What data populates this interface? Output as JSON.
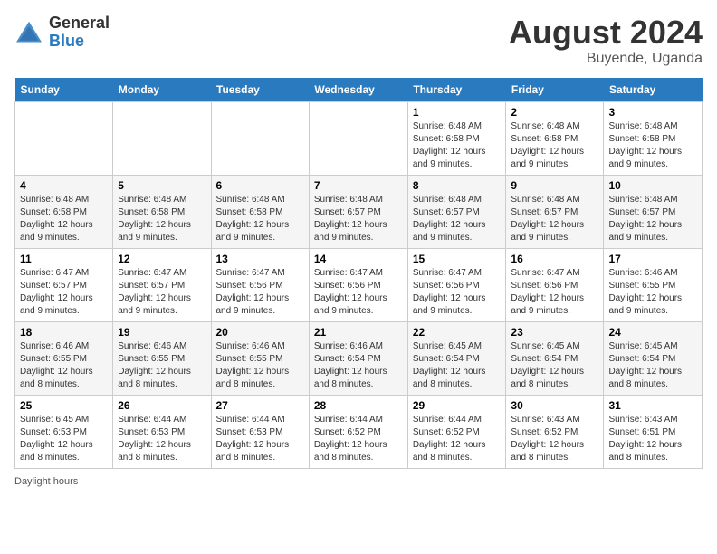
{
  "header": {
    "logo_general": "General",
    "logo_blue": "Blue",
    "month_year": "August 2024",
    "location": "Buyende, Uganda"
  },
  "columns": [
    "Sunday",
    "Monday",
    "Tuesday",
    "Wednesday",
    "Thursday",
    "Friday",
    "Saturday"
  ],
  "weeks": [
    [
      {
        "day": "",
        "info": ""
      },
      {
        "day": "",
        "info": ""
      },
      {
        "day": "",
        "info": ""
      },
      {
        "day": "",
        "info": ""
      },
      {
        "day": "1",
        "info": "Sunrise: 6:48 AM\nSunset: 6:58 PM\nDaylight: 12 hours and 9 minutes."
      },
      {
        "day": "2",
        "info": "Sunrise: 6:48 AM\nSunset: 6:58 PM\nDaylight: 12 hours and 9 minutes."
      },
      {
        "day": "3",
        "info": "Sunrise: 6:48 AM\nSunset: 6:58 PM\nDaylight: 12 hours and 9 minutes."
      }
    ],
    [
      {
        "day": "4",
        "info": "Sunrise: 6:48 AM\nSunset: 6:58 PM\nDaylight: 12 hours and 9 minutes."
      },
      {
        "day": "5",
        "info": "Sunrise: 6:48 AM\nSunset: 6:58 PM\nDaylight: 12 hours and 9 minutes."
      },
      {
        "day": "6",
        "info": "Sunrise: 6:48 AM\nSunset: 6:58 PM\nDaylight: 12 hours and 9 minutes."
      },
      {
        "day": "7",
        "info": "Sunrise: 6:48 AM\nSunset: 6:57 PM\nDaylight: 12 hours and 9 minutes."
      },
      {
        "day": "8",
        "info": "Sunrise: 6:48 AM\nSunset: 6:57 PM\nDaylight: 12 hours and 9 minutes."
      },
      {
        "day": "9",
        "info": "Sunrise: 6:48 AM\nSunset: 6:57 PM\nDaylight: 12 hours and 9 minutes."
      },
      {
        "day": "10",
        "info": "Sunrise: 6:48 AM\nSunset: 6:57 PM\nDaylight: 12 hours and 9 minutes."
      }
    ],
    [
      {
        "day": "11",
        "info": "Sunrise: 6:47 AM\nSunset: 6:57 PM\nDaylight: 12 hours and 9 minutes."
      },
      {
        "day": "12",
        "info": "Sunrise: 6:47 AM\nSunset: 6:57 PM\nDaylight: 12 hours and 9 minutes."
      },
      {
        "day": "13",
        "info": "Sunrise: 6:47 AM\nSunset: 6:56 PM\nDaylight: 12 hours and 9 minutes."
      },
      {
        "day": "14",
        "info": "Sunrise: 6:47 AM\nSunset: 6:56 PM\nDaylight: 12 hours and 9 minutes."
      },
      {
        "day": "15",
        "info": "Sunrise: 6:47 AM\nSunset: 6:56 PM\nDaylight: 12 hours and 9 minutes."
      },
      {
        "day": "16",
        "info": "Sunrise: 6:47 AM\nSunset: 6:56 PM\nDaylight: 12 hours and 9 minutes."
      },
      {
        "day": "17",
        "info": "Sunrise: 6:46 AM\nSunset: 6:55 PM\nDaylight: 12 hours and 9 minutes."
      }
    ],
    [
      {
        "day": "18",
        "info": "Sunrise: 6:46 AM\nSunset: 6:55 PM\nDaylight: 12 hours and 8 minutes."
      },
      {
        "day": "19",
        "info": "Sunrise: 6:46 AM\nSunset: 6:55 PM\nDaylight: 12 hours and 8 minutes."
      },
      {
        "day": "20",
        "info": "Sunrise: 6:46 AM\nSunset: 6:55 PM\nDaylight: 12 hours and 8 minutes."
      },
      {
        "day": "21",
        "info": "Sunrise: 6:46 AM\nSunset: 6:54 PM\nDaylight: 12 hours and 8 minutes."
      },
      {
        "day": "22",
        "info": "Sunrise: 6:45 AM\nSunset: 6:54 PM\nDaylight: 12 hours and 8 minutes."
      },
      {
        "day": "23",
        "info": "Sunrise: 6:45 AM\nSunset: 6:54 PM\nDaylight: 12 hours and 8 minutes."
      },
      {
        "day": "24",
        "info": "Sunrise: 6:45 AM\nSunset: 6:54 PM\nDaylight: 12 hours and 8 minutes."
      }
    ],
    [
      {
        "day": "25",
        "info": "Sunrise: 6:45 AM\nSunset: 6:53 PM\nDaylight: 12 hours and 8 minutes."
      },
      {
        "day": "26",
        "info": "Sunrise: 6:44 AM\nSunset: 6:53 PM\nDaylight: 12 hours and 8 minutes."
      },
      {
        "day": "27",
        "info": "Sunrise: 6:44 AM\nSunset: 6:53 PM\nDaylight: 12 hours and 8 minutes."
      },
      {
        "day": "28",
        "info": "Sunrise: 6:44 AM\nSunset: 6:52 PM\nDaylight: 12 hours and 8 minutes."
      },
      {
        "day": "29",
        "info": "Sunrise: 6:44 AM\nSunset: 6:52 PM\nDaylight: 12 hours and 8 minutes."
      },
      {
        "day": "30",
        "info": "Sunrise: 6:43 AM\nSunset: 6:52 PM\nDaylight: 12 hours and 8 minutes."
      },
      {
        "day": "31",
        "info": "Sunrise: 6:43 AM\nSunset: 6:51 PM\nDaylight: 12 hours and 8 minutes."
      }
    ]
  ],
  "footer": {
    "daylight_hours": "Daylight hours"
  }
}
